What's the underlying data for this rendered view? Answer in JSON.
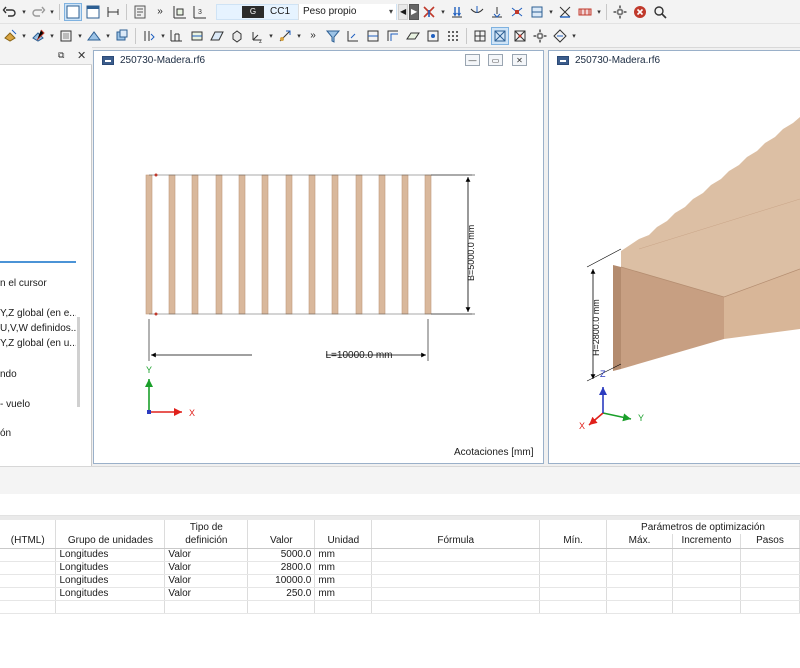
{
  "toolbar": {
    "load_case": {
      "type_badge": "G",
      "id": "CC1",
      "name": "Peso propio"
    }
  },
  "navigator": {
    "items": [
      {
        "text": "n el cursor"
      },
      {
        "text": "Y,Z global (en e..."
      },
      {
        "text": "U,V,W definidos..."
      },
      {
        "text": "Y,Z global (en u..."
      },
      {
        "text": "ndo"
      },
      {
        "text": "- vuelo"
      },
      {
        "text": "ón"
      }
    ]
  },
  "window_left": {
    "title": "250730-Madera.rf6",
    "dim_length": "L=10000.0 mm",
    "dim_width": "B=5000.0 mm",
    "axis_x": "X",
    "axis_y": "Y",
    "status": "Acotaciones [mm]"
  },
  "window_right": {
    "title": "250730-Madera.rf6",
    "dim_height": "H=2800.0 mm",
    "axis_x": "X",
    "axis_y": "Y",
    "axis_z": "Z"
  },
  "table": {
    "group_header": "Parámetros de optimización",
    "columns": {
      "name": "(HTML)",
      "unit_group": "Grupo de unidades",
      "def_type_l1": "Tipo de",
      "def_type_l2": "definición",
      "value": "Valor",
      "unit": "Unidad",
      "formula": "Fórmula",
      "min": "Mín.",
      "max": "Máx.",
      "increment": "Incremento",
      "steps": "Pasos"
    },
    "rows": [
      {
        "unit_group": "Longitudes",
        "def_type": "Valor",
        "value": "5000.0",
        "unit": "mm"
      },
      {
        "unit_group": "Longitudes",
        "def_type": "Valor",
        "value": "2800.0",
        "unit": "mm"
      },
      {
        "unit_group": "Longitudes",
        "def_type": "Valor",
        "value": "10000.0",
        "unit": "mm"
      },
      {
        "unit_group": "Longitudes",
        "def_type": "Valor",
        "value": "250.0",
        "unit": "mm"
      }
    ]
  }
}
